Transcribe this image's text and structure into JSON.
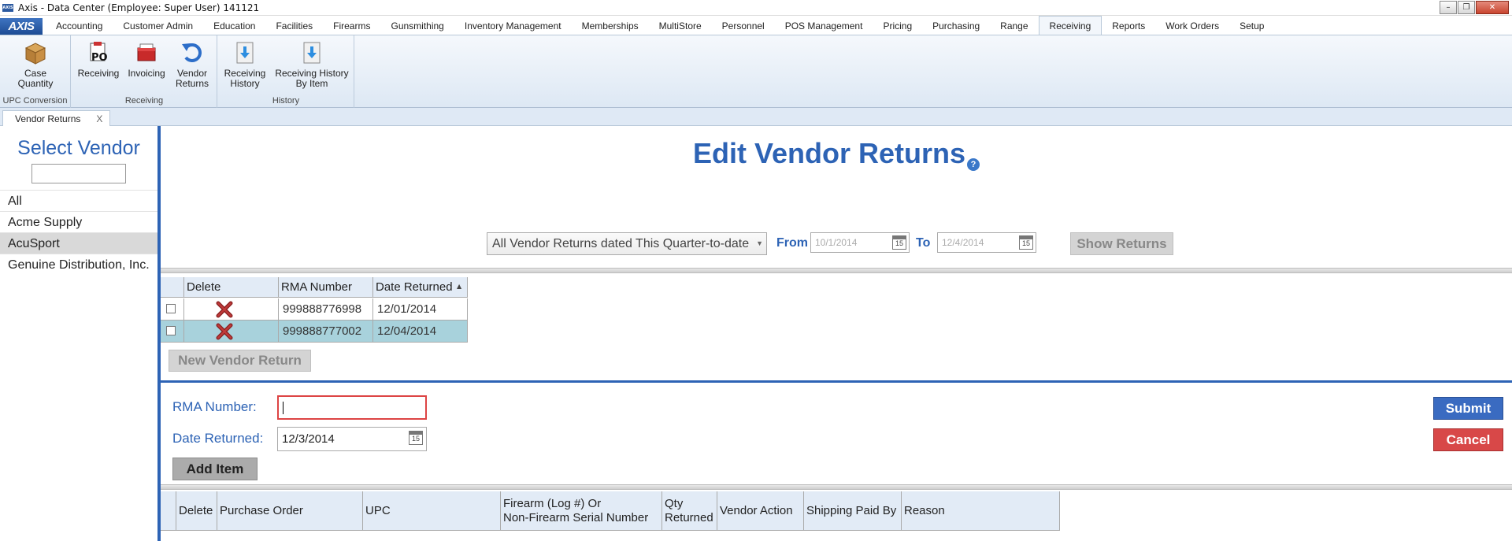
{
  "window": {
    "title": "Axis - Data Center  (Employee: Super User) 141121",
    "app_icon_text": "AXIS",
    "controls": [
      "–",
      "❐",
      "✕"
    ]
  },
  "menu": {
    "logo": "AXIS",
    "tabs": [
      "Accounting",
      "Customer Admin",
      "Education",
      "Facilities",
      "Firearms",
      "Gunsmithing",
      "Inventory Management",
      "Memberships",
      "MultiStore",
      "Personnel",
      "POS Management",
      "Pricing",
      "Purchasing",
      "Range",
      "Receiving",
      "Reports",
      "Work Orders",
      "Setup"
    ],
    "active_tab": "Receiving"
  },
  "ribbon": {
    "groups": [
      {
        "label": "UPC Conversion",
        "buttons": [
          {
            "line1": "Case",
            "line2": "Quantity",
            "icon": "box-icon"
          }
        ]
      },
      {
        "label": "Receiving",
        "buttons": [
          {
            "line1": "Receiving",
            "line2": "",
            "icon": "po-icon"
          },
          {
            "line1": "Invoicing",
            "line2": "",
            "icon": "invoice-icon"
          },
          {
            "line1": "Vendor",
            "line2": "Returns",
            "icon": "return-arrow-icon"
          }
        ]
      },
      {
        "label": "History",
        "buttons": [
          {
            "line1": "Receiving",
            "line2": "History",
            "icon": "download-doc-icon"
          },
          {
            "line1": "Receiving History",
            "line2": "By Item",
            "icon": "download-doc-icon"
          }
        ]
      }
    ]
  },
  "doc_tab": {
    "label": "Vendor Returns",
    "close": "X"
  },
  "vendor_panel": {
    "title": "Select Vendor",
    "search_value": "",
    "items": [
      "All",
      "Acme Supply",
      "AcuSport",
      "Genuine Distribution, Inc."
    ],
    "selected": "AcuSport"
  },
  "page": {
    "title": "Edit Vendor Returns",
    "help": "?"
  },
  "filter": {
    "range_select": "All Vendor Returns dated This Quarter-to-date",
    "from_label": "From",
    "from_value": "10/1/2014",
    "to_label": "To",
    "to_value": "12/4/2014",
    "calendar_glyph": "15",
    "show_button": "Show Returns"
  },
  "returns_grid": {
    "columns": [
      "Delete",
      "RMA Number",
      "Date Returned"
    ],
    "sort_indicator": "▲",
    "rows": [
      {
        "rma": "999888776998",
        "date": "12/01/2014",
        "selected": false
      },
      {
        "rma": "999888777002",
        "date": "12/04/2014",
        "selected": true
      }
    ]
  },
  "new_button": "New Vendor Return",
  "form": {
    "rma_label": "RMA Number:",
    "rma_value": "",
    "date_label": "Date Returned:",
    "date_value": "12/3/2014",
    "add_item": "Add Item",
    "submit": "Submit",
    "cancel": "Cancel"
  },
  "items_grid": {
    "columns": [
      "Delete",
      "Purchase Order",
      "UPC",
      "Firearm (Log #) Or",
      "Non-Firearm Serial Number",
      "Qty",
      "Returned",
      "Vendor Action",
      "Shipping Paid By",
      "Reason"
    ]
  },
  "colors": {
    "accent": "#2d63b5",
    "selected_row": "#a8d2dc",
    "submit": "#3a6bc1",
    "cancel": "#d84848"
  }
}
